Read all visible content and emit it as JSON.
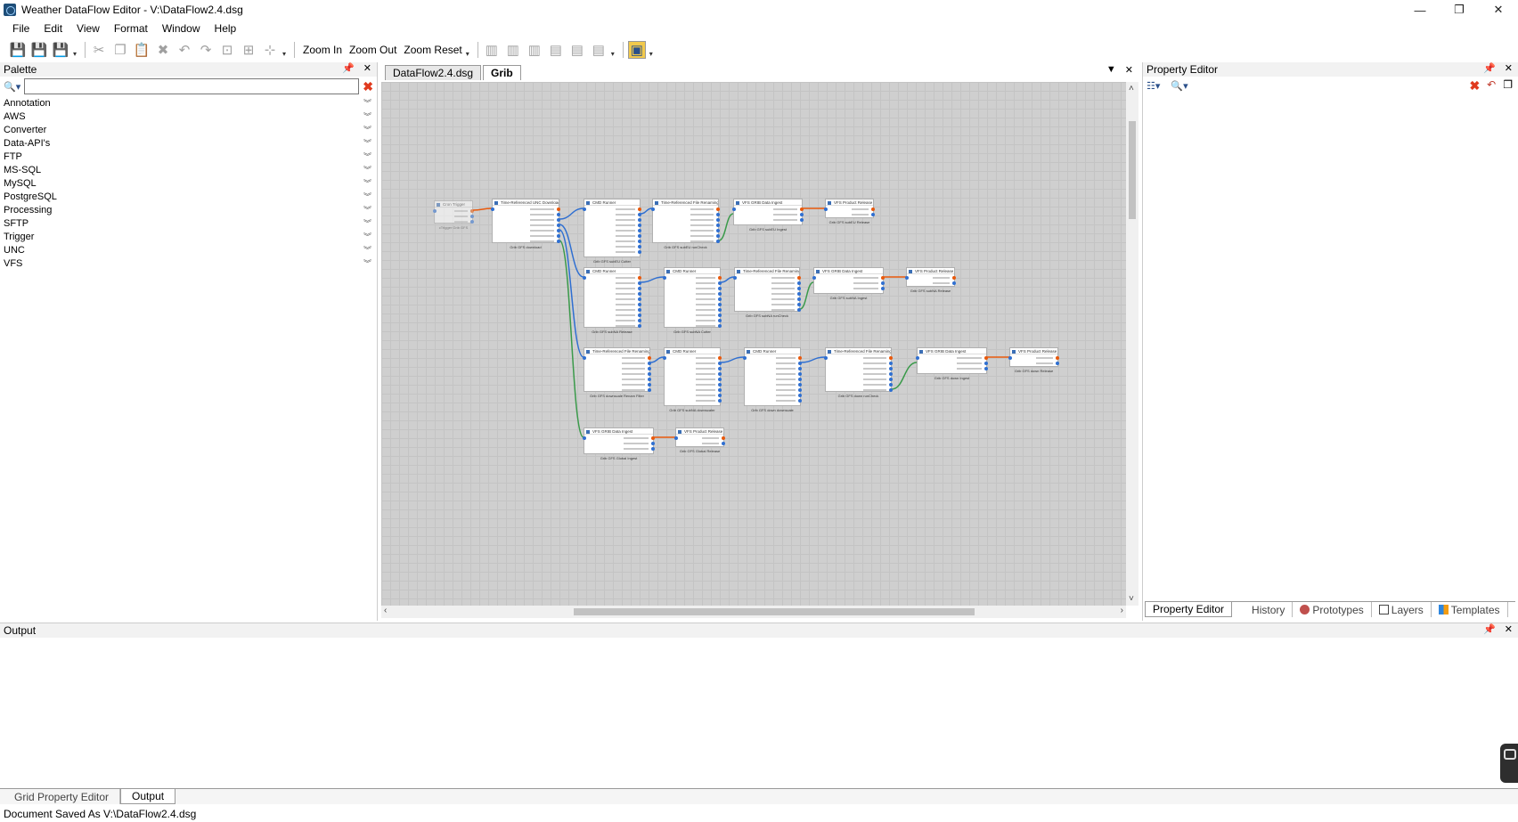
{
  "window": {
    "title": "Weather DataFlow Editor - V:\\DataFlow2.4.dsg",
    "controls": [
      "—",
      "❐",
      "✕"
    ]
  },
  "menu": [
    "File",
    "Edit",
    "View",
    "Format",
    "Window",
    "Help"
  ],
  "toolbar": {
    "zoom_in": "Zoom In",
    "zoom_out": "Zoom Out",
    "zoom_reset": "Zoom Reset"
  },
  "palette": {
    "title": "Palette",
    "search_value": "",
    "categories": [
      "Annotation",
      "AWS",
      "Converter",
      "Data-API's",
      "FTP",
      "MS-SQL",
      "MySQL",
      "PostgreSQL",
      "Processing",
      "SFTP",
      "Trigger",
      "UNC",
      "VFS"
    ]
  },
  "editor": {
    "tabs": [
      {
        "label": "DataFlow2.4.dsg",
        "active": false
      },
      {
        "label": "Grib",
        "active": true
      }
    ]
  },
  "canvas": {
    "nodes": [
      {
        "id": "trigger",
        "title": "Cron Trigger",
        "caption": "cTrigger Grib GFS",
        "faded": true
      },
      {
        "id": "unc",
        "title": "Time-Referenced UNC Download",
        "caption": "Grib GFS download"
      },
      {
        "id": "cmd1",
        "title": "CMD Runner",
        "caption": "Grib GFS subEU Cutter"
      },
      {
        "id": "ren1",
        "title": "Time-Referenced File Renaming",
        "caption": "Grib GFS subEU runCheck"
      },
      {
        "id": "ing1",
        "title": "VFS GRIB Data Ingest",
        "caption": "Grib GFS subEU Ingest"
      },
      {
        "id": "rel1",
        "title": "VFS Product Release",
        "caption": "Grib GFS subEU Release"
      },
      {
        "id": "cmd2",
        "title": "CMD Runner",
        "caption": "Grib GFS subNA Release"
      },
      {
        "id": "cmd3",
        "title": "CMD Runner",
        "caption": "Grib GFS subNA Cutter"
      },
      {
        "id": "ren2",
        "title": "Time-Referenced File Renaming",
        "caption": "Grib GFS subNA runCheck"
      },
      {
        "id": "ing2",
        "title": "VFS GRIB Data Ingest",
        "caption": "Grib GFS subNA Ingest"
      },
      {
        "id": "rel2",
        "title": "VFS Product Release",
        "caption": "Grib GFS subNA Release"
      },
      {
        "id": "ren3",
        "title": "Time-Referenced File Renaming",
        "caption": "Grib GFS downscale Renam Filter"
      },
      {
        "id": "cmd4",
        "title": "CMD Runner",
        "caption": "Grib GFS subNA downscaler"
      },
      {
        "id": "cmd5",
        "title": "CMD Runner",
        "caption": "Grib GFS down downscale"
      },
      {
        "id": "ren4",
        "title": "Time-Referenced File Renaming",
        "caption": "Grib GFS down runCheck"
      },
      {
        "id": "ing3",
        "title": "VFS GRIB Data Ingest",
        "caption": "Grib GFS down Ingest"
      },
      {
        "id": "rel3",
        "title": "VFS Product Release",
        "caption": "Grib GFS down Release"
      },
      {
        "id": "ing4",
        "title": "VFS GRIB Data Ingest",
        "caption": "Grib GFS Global Ingest"
      },
      {
        "id": "rel4",
        "title": "VFS Product Release",
        "caption": "Grib GFS Global Release"
      }
    ]
  },
  "property_editor": {
    "title": "Property Editor",
    "tabs": [
      "Property Editor",
      "History",
      "Prototypes",
      "Layers",
      "Templates"
    ]
  },
  "output": {
    "title": "Output",
    "tabs": [
      "Grid Property Editor",
      "Output"
    ]
  },
  "status": "Document Saved As V:\\DataFlow2.4.dsg"
}
